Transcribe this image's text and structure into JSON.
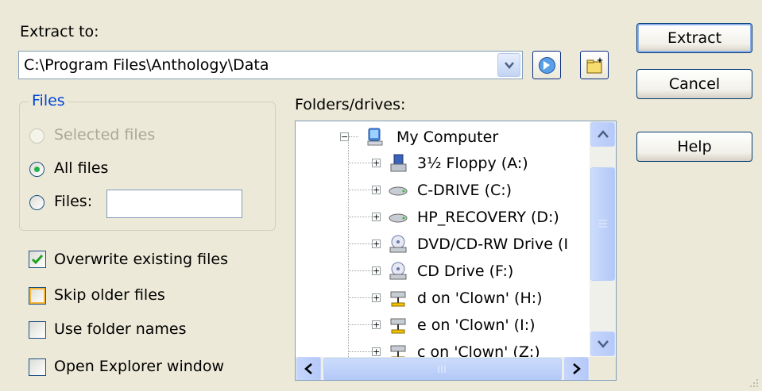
{
  "extract_to": {
    "label": "Extract to:",
    "path": "C:\\Program Files\\Anthology\\Data"
  },
  "buttons": {
    "extract": "Extract",
    "cancel": "Cancel",
    "help": "Help"
  },
  "files_group": {
    "title": "Files",
    "selected_files": "Selected files",
    "all_files": "All files",
    "files": "Files:",
    "files_value": "",
    "selected_option": "all_files"
  },
  "options": {
    "overwrite": {
      "label": "Overwrite existing files",
      "checked": true
    },
    "skip_older": {
      "label": "Skip older files",
      "checked": false
    },
    "use_folder_names": {
      "label": "Use folder names",
      "checked": false
    },
    "open_explorer": {
      "label": "Open Explorer window",
      "checked": false
    }
  },
  "folders": {
    "label": "Folders/drives:",
    "root": {
      "label": "My Computer",
      "icon": "computer-icon",
      "expanded": true
    },
    "items": [
      {
        "label": "3½ Floppy (A:)",
        "icon": "floppy-drive-icon"
      },
      {
        "label": "C-DRIVE (C:)",
        "icon": "hard-drive-icon"
      },
      {
        "label": "HP_RECOVERY (D:)",
        "icon": "hard-drive-icon"
      },
      {
        "label": "DVD/CD-RW Drive (I",
        "icon": "cd-drive-icon"
      },
      {
        "label": "CD Drive (F:)",
        "icon": "cd-drive-icon"
      },
      {
        "label": "d on 'Clown' (H:)",
        "icon": "network-drive-icon"
      },
      {
        "label": "e on 'Clown' (I:)",
        "icon": "network-drive-icon"
      },
      {
        "label": "c on 'Clown' (Z:)",
        "icon": "network-drive-icon"
      }
    ]
  },
  "colors": {
    "dialog_bg": "#ece9d8",
    "group_title": "#0046d5",
    "radio_dot": "#22b14c",
    "check_mark": "#21a121",
    "focus_highlight": "#f8b636"
  }
}
